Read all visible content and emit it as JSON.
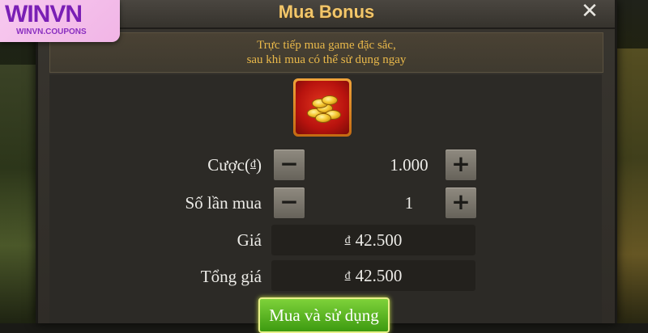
{
  "logo": {
    "main": "WINVN",
    "sub": "WINVN.COUPONS"
  },
  "dialog": {
    "title": "Mua Bonus",
    "close_icon": "close-icon",
    "banner_line1": "Trực tiếp mua game đặc sắc,",
    "banner_line2": "sau khi mua có thể sử dụng ngay",
    "item_icon": "gold-coins-icon"
  },
  "form": {
    "bet_label": "Cược(",
    "bet_label_currency": "đ",
    "bet_label_close": ")",
    "bet_value": "1.000",
    "times_label": "Số lần mua",
    "times_value": "1",
    "price_label": "Giá",
    "price_currency": "đ",
    "price_value": "42.500",
    "total_label": "Tổng giá",
    "total_currency": "đ",
    "total_value": "42.500",
    "minus_symbol": "−",
    "plus_symbol": "+"
  },
  "buy_button": "Mua và sử dụng",
  "colors": {
    "title": "#f2c66a",
    "banner_text": "#e9b84a",
    "buy_button": "#5cb820",
    "logo_text": "#7a1fb5"
  }
}
